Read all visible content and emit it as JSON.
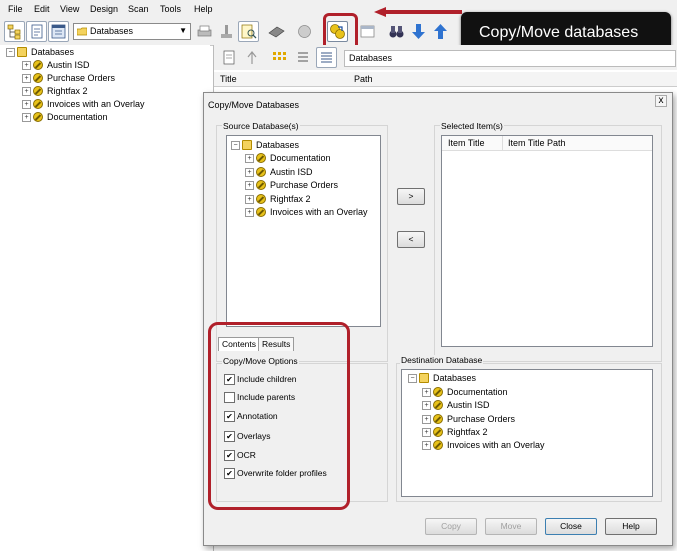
{
  "menu": [
    "File",
    "Edit",
    "View",
    "Design",
    "Scan",
    "Tools",
    "Help"
  ],
  "toolbar": {
    "db_select_value": "Databases"
  },
  "left_tree": {
    "root": "Databases",
    "items": [
      "Austin ISD",
      "Purchase Orders",
      "Rightfax 2",
      "Invoices with an Overlay",
      "Documentation"
    ]
  },
  "right_panel": {
    "path_field": "Databases",
    "columns": [
      "Title",
      "Path"
    ]
  },
  "callout": {
    "text": "Copy/Move databases"
  },
  "dialog": {
    "title": "Copy/Move Databases",
    "close_glyph": "x",
    "source_label": "Source Database(s)",
    "source_tree": {
      "root": "Databases",
      "items": [
        "Documentation",
        "Austin ISD",
        "Purchase Orders",
        "Rightfax 2",
        "Invoices with an Overlay"
      ]
    },
    "add_button": ">",
    "remove_button": "<",
    "selected_label": "Selected Item(s)",
    "selected_columns": [
      "Item Title",
      "Item Title Path"
    ],
    "tabs": [
      "Contents",
      "Results"
    ],
    "options_label": "Copy/Move Options",
    "options": [
      {
        "label": "Include children",
        "checked": true
      },
      {
        "label": "Include parents",
        "checked": false
      },
      {
        "label": "Annotation",
        "checked": true
      },
      {
        "label": "Overlays",
        "checked": true
      },
      {
        "label": "OCR",
        "checked": true
      },
      {
        "label": "Overwrite folder profiles",
        "checked": true
      }
    ],
    "destination_label": "Destination Database",
    "destination_tree": {
      "root": "Databases",
      "items": [
        "Documentation",
        "Austin ISD",
        "Purchase Orders",
        "Rightfax 2",
        "Invoices with an Overlay"
      ]
    },
    "buttons": {
      "copy": "Copy",
      "move": "Move",
      "close": "Close",
      "help": "Help"
    }
  },
  "colors": {
    "highlight": "#b0202a",
    "callout_bg": "#111111",
    "db_icon": "#e8c21a"
  }
}
